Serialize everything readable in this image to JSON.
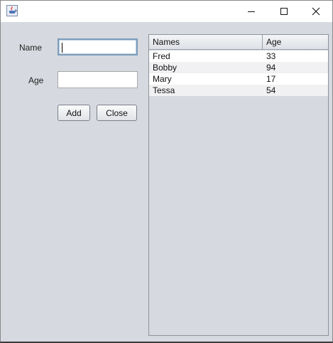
{
  "window": {
    "controls": {
      "minimize_icon": "minimize-icon",
      "maximize_icon": "maximize-icon",
      "close_icon": "close-icon"
    }
  },
  "form": {
    "name_label": "Name",
    "name_value": "",
    "age_label": "Age",
    "age_value": "",
    "add_label": "Add",
    "close_label": "Close"
  },
  "table": {
    "columns": [
      "Names",
      "Age"
    ],
    "rows": [
      {
        "name": "Fred",
        "age": "33"
      },
      {
        "name": "Bobby",
        "age": "94"
      },
      {
        "name": "Mary",
        "age": "17"
      },
      {
        "name": "Tessa",
        "age": "54"
      }
    ]
  },
  "colors": {
    "background": "#d6d9df",
    "focus_border": "#7f9db9"
  }
}
